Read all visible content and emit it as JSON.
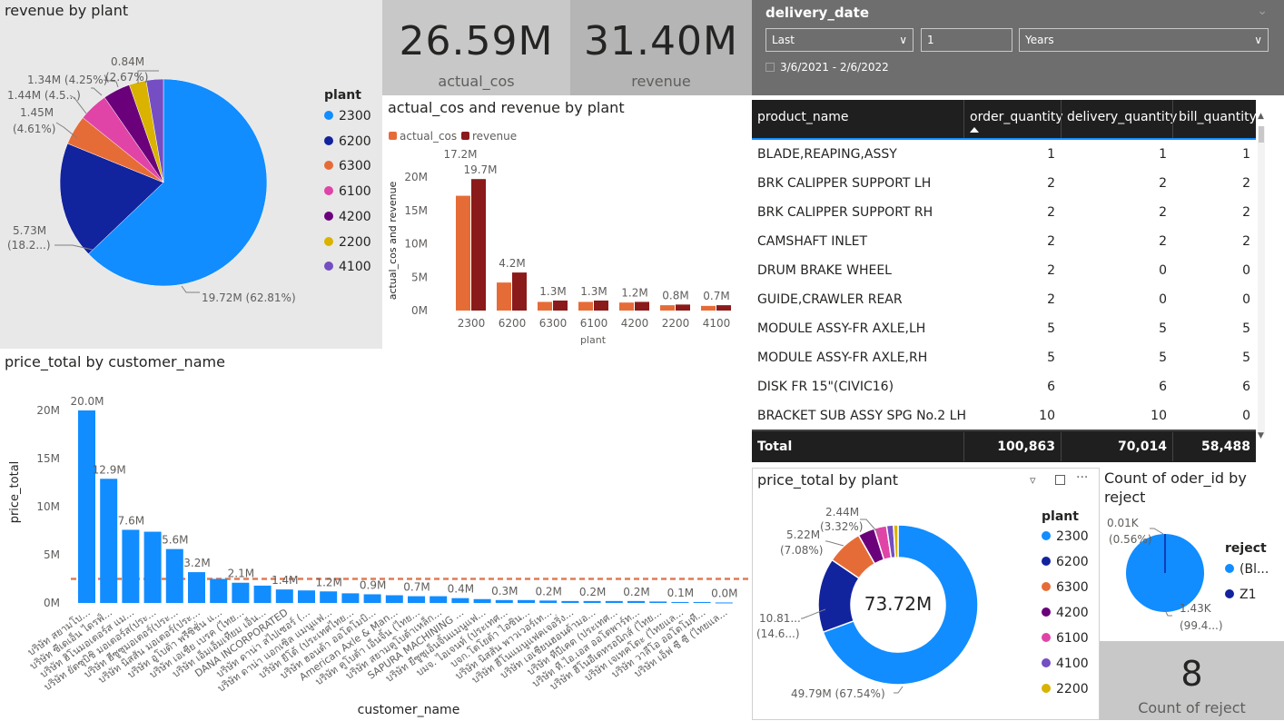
{
  "colors": {
    "blue": "#118dff",
    "navy": "#12239e",
    "orange": "#e66c37",
    "magenta": "#e044a7",
    "purple": "#6b007b",
    "yellow": "#d9b300",
    "violet": "#744ec2",
    "darkred": "#8b1a1a",
    "ref_line": "#e07b54"
  },
  "kpis": [
    {
      "value": "26.59M",
      "label": "actual_cos"
    },
    {
      "value": "31.40M",
      "label": "revenue"
    }
  ],
  "slicer": {
    "title": "delivery_date",
    "mode": "Last",
    "count": "1",
    "unit": "Years",
    "range": "3/6/2021 - 2/6/2022"
  },
  "revenue_pie": {
    "title": "revenue by plant",
    "legend_title": "plant",
    "legend": [
      "2300",
      "6200",
      "6300",
      "6100",
      "4200",
      "2200",
      "4100"
    ],
    "labels": [
      "19.72M (62.81%)",
      "5.73M",
      "(18.2...)",
      "1.45M",
      "(4.61%)",
      "1.44M (4.5...)",
      "1.34M (4.25%)",
      "0.84M",
      "(2.67%)"
    ]
  },
  "bar_chart": {
    "title": "actual_cos and revenue by plant",
    "legend": [
      "actual_cos",
      "revenue"
    ],
    "ylabel": "actual_cos and revenue",
    "xlabel": "plant",
    "yticks": [
      "20M",
      "15M",
      "10M",
      "5M",
      "0M"
    ],
    "actual_labels": [
      "17.2M",
      "4.2M",
      "1.3M",
      "1.3M",
      "1.2M",
      "0.8M",
      "0.7M"
    ],
    "revenue_labels": [
      "19.7M"
    ]
  },
  "customer_chart": {
    "title": "price_total by customer_name",
    "ylabel": "price_total",
    "xlabel": "customer_name",
    "yticks": [
      "20M",
      "15M",
      "10M",
      "5M",
      "0M"
    ],
    "data_labels": [
      "20.0M",
      "12.9M",
      "7.6M",
      "5.6M",
      "3.2M",
      "2.1M",
      "1.4M",
      "1.2M",
      "0.9M",
      "0.7M",
      "0.4M",
      "0.3M",
      "0.2M",
      "0.2M",
      "0.2M",
      "0.1M",
      "0.0M"
    ],
    "categories": [
      "บริษัท สยามโบ...",
      "บริษัท ซีเดเอ็น ไดรฟ์...",
      "บริษัท ฮิโนมอเตอร์ส แม...",
      "บริษัท ยัตซุบิชิ มอเตอร์ส(ประ...",
      "บริษัท ฮีซูซุมอเตอร์(ประ...",
      "บริษัท นิสสัน มอเตอร์(ประ...",
      "บริษัท อูโบต้า พรีซิชั่น แ...",
      "บริษัท เอเชีย เบรค (ไทย...",
      "บริษัท เอ็มเอ็มเทียม เอ็น...",
      "DANA INCORPORATED",
      "บริษัท ดาน่า สไปเซอร์ (...",
      "บริษัท ดาน่า แอกเซิล แมนูแฟ...",
      "บริษัท ยีโต้ (ประเทศไทย...",
      "บริษัท ฮอนด้า ออโตโมบิ...",
      "American Axle & Man...",
      "บริษัท คูโบต้า เอ็นจิ้น (ไทย...",
      "บริษัท สยามคูโบต้าเหล็ก...",
      "SAPURA MACHINING ...",
      "บริษัท ยีซูซุเอ็นจิ้นแมนูแฟ...",
      "บมจ. ไอเจนท์ (ประเทศ...",
      "บจก.โตโยต้า ไอซิน...",
      "บริษัท นิสสัน พาวเวอร์เท...",
      "บริษัท ฮีโนแมนูแฟคเจอริ่ง...",
      "บริษัท เอเชียนฮอนด้ามอ...",
      "บริษัท ทีบีเคต (ประเทศ...",
      "บริษัท ที.ไอ.เอส ออโตพาร์ท...",
      "บริษัท ฮีโนอีเดทรอนิกส์ (ไทย...",
      "บริษัท เจเทคโตะ (ไทยแล...",
      "บริษัท วาลีโอ ออโตโมที...",
      "บริษัท เอ็ฟ ซี ซี (ไทยแล..."
    ]
  },
  "table": {
    "columns": [
      "product_name",
      "order_quantity",
      "delivery_quantity",
      "bill_quantity"
    ],
    "rows": [
      [
        "BLADE,REAPING,ASSY",
        "1",
        "1",
        "1"
      ],
      [
        "BRK CALIPPER SUPPORT LH",
        "2",
        "2",
        "2"
      ],
      [
        "BRK CALIPPER SUPPORT RH",
        "2",
        "2",
        "2"
      ],
      [
        "CAMSHAFT INLET",
        "2",
        "2",
        "2"
      ],
      [
        "DRUM BRAKE WHEEL",
        "2",
        "0",
        "0"
      ],
      [
        "GUIDE,CRAWLER REAR",
        "2",
        "0",
        "0"
      ],
      [
        "MODULE ASSY-FR AXLE,LH",
        "5",
        "5",
        "5"
      ],
      [
        "MODULE ASSY-FR AXLE,RH",
        "5",
        "5",
        "5"
      ],
      [
        "DISK FR 15\"(CIVIC16)",
        "6",
        "6",
        "6"
      ],
      [
        "BRACKET SUB ASSY SPG No.2 LH",
        "10",
        "10",
        "0"
      ]
    ],
    "total": [
      "Total",
      "100,863",
      "70,014",
      "58,488"
    ]
  },
  "donut": {
    "title": "price_total by plant",
    "center": "73.72M",
    "legend_title": "plant",
    "legend": [
      "2300",
      "6200",
      "6300",
      "4200",
      "6100",
      "4100",
      "2200"
    ],
    "labels": [
      "2.44M",
      "(3.32%)",
      "5.22M",
      "(7.08%)",
      "10.81...",
      "(14.6...)",
      "49.79M (67.54%)"
    ]
  },
  "reject_pie": {
    "title_line1": "Count of oder_id by",
    "title_line2": "reject",
    "legend_title": "reject",
    "legend": [
      "(Bl...",
      "Z1"
    ],
    "labels": [
      "0.01K",
      "(0.56%)",
      "1.43K",
      "(99.4...)"
    ]
  },
  "reject_card": {
    "value": "8",
    "label": "Count of reject"
  }
}
